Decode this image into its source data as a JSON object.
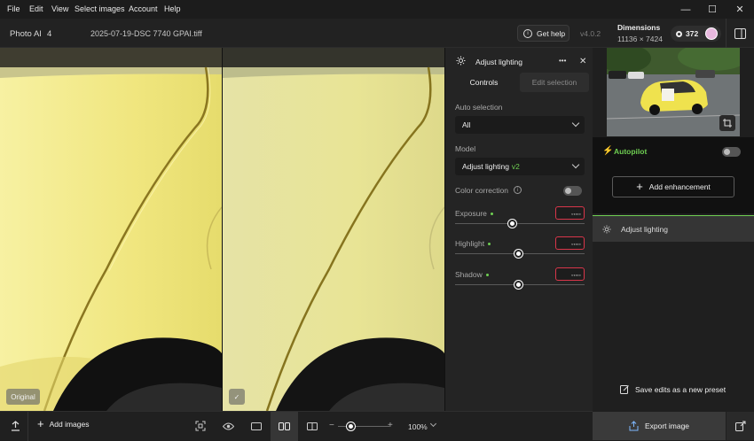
{
  "menu": {
    "file": "File",
    "edit": "Edit",
    "view": "View",
    "select_images": "Select images",
    "account": "Account",
    "help": "Help"
  },
  "window_controls": {
    "minimize": "—",
    "maximize": "☐",
    "close": "✕"
  },
  "header": {
    "app_name": "Photo AI",
    "app_version_major": "4",
    "filename": "2025-07-19-DSC 7740 GPAI.tiff",
    "get_help": "Get help",
    "version": "v4.0.2",
    "dimensions_label": "Dimensions",
    "dimensions_value": "11136 × 7424",
    "credits": "372"
  },
  "viewer": {
    "original_tag": "Original",
    "check_tag": "✓"
  },
  "bottombar": {
    "add_images": "Add images",
    "zoom": "100%",
    "zoom_level": 0.25
  },
  "panel": {
    "title": "Adjust lighting",
    "more": "•••",
    "close": "✕",
    "tabs": {
      "controls": "Controls",
      "edit_selection": "Edit selection"
    },
    "auto_selection_label": "Auto selection",
    "auto_selection_value": "All",
    "model_label": "Model",
    "model_value": "Adjust lighting",
    "model_badge": "v2",
    "color_correction_label": "Color correction",
    "color_correction_info": "i",
    "color_correction_on": false,
    "sliders": [
      {
        "label": "Exposure",
        "value": ",,,,,",
        "level": 0.45
      },
      {
        "label": "Highlight",
        "value": ",,,,,",
        "level": 0.5
      },
      {
        "label": "Shadow",
        "value": ",,,,,",
        "level": 0.5
      }
    ]
  },
  "sidebar": {
    "autopilot": "Autopilot",
    "autopilot_on": false,
    "add_enhancement": "Add enhancement",
    "enhancement_item": "Adjust lighting",
    "save_preset": "Save edits as a new preset",
    "export": "Export image"
  },
  "colors": {
    "accent_green": "#6fcf52",
    "error_red": "#d9364a"
  }
}
